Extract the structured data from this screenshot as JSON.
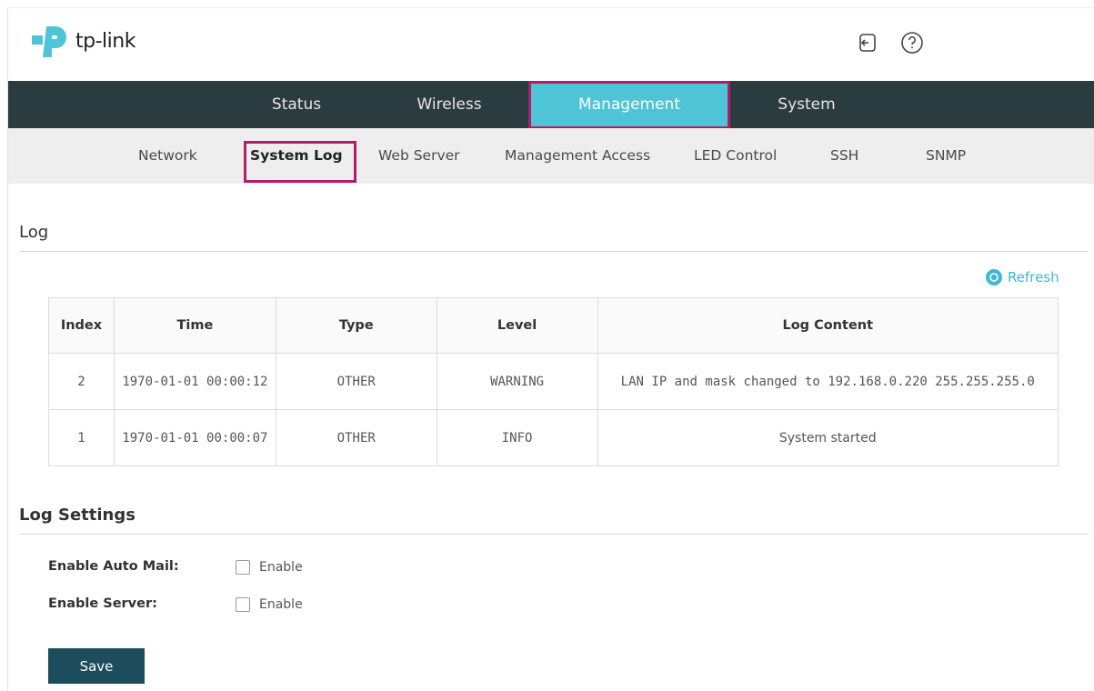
{
  "brand": {
    "name": "tp-link"
  },
  "header": {
    "logout_icon": "logout-icon",
    "help_icon": "help-icon"
  },
  "main_nav": {
    "tabs": [
      {
        "label": "Status"
      },
      {
        "label": "Wireless"
      },
      {
        "label": "Management",
        "active": true
      },
      {
        "label": "System"
      }
    ]
  },
  "sub_nav": {
    "items": [
      {
        "label": "Network"
      },
      {
        "label": "System Log",
        "active": true
      },
      {
        "label": "Web Server"
      },
      {
        "label": "Management Access"
      },
      {
        "label": "LED Control"
      },
      {
        "label": "SSH"
      },
      {
        "label": "SNMP"
      }
    ]
  },
  "log_section": {
    "title": "Log",
    "refresh_label": "Refresh",
    "columns": [
      "Index",
      "Time",
      "Type",
      "Level",
      "Log Content"
    ],
    "rows": [
      [
        "2",
        "1970-01-01 00:00:12",
        "OTHER",
        "WARNING",
        "LAN IP and mask changed to 192.168.0.220 255.255.255.0"
      ],
      [
        "1",
        "1970-01-01 00:00:07",
        "OTHER",
        "INFO",
        "System started"
      ]
    ]
  },
  "log_settings": {
    "title": "Log Settings",
    "auto_mail": {
      "label": "Enable Auto Mail:",
      "checkbox_label": "Enable",
      "checked": false
    },
    "server": {
      "label": "Enable Server:",
      "checkbox_label": "Enable",
      "checked": false
    },
    "save_label": "Save"
  },
  "colors": {
    "nav_bg": "#2b3c40",
    "active_tab": "#4ec5d6",
    "highlight_border": "#b21d6b",
    "accent": "#3fb7d6",
    "save_button": "#1d4d5c"
  }
}
